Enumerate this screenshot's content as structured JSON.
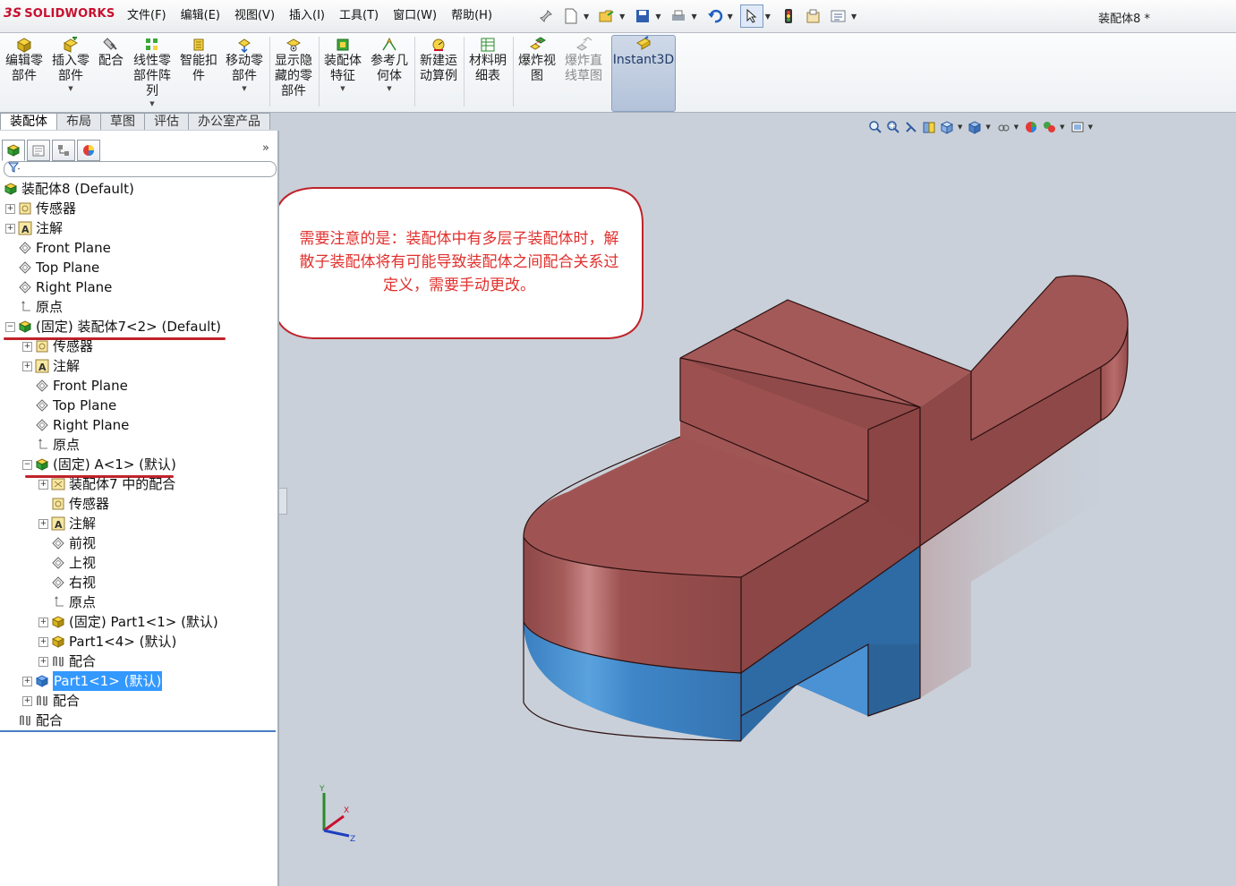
{
  "app": {
    "logo_text": "SOLIDWORKS",
    "document_title": "装配体8 *"
  },
  "menubar": {
    "items": [
      "文件(F)",
      "编辑(E)",
      "视图(V)",
      "插入(I)",
      "工具(T)",
      "窗口(W)",
      "帮助(H)"
    ]
  },
  "quick_toolbar": {
    "icons": [
      "pin-icon",
      "new-document-icon",
      "open-icon",
      "save-icon",
      "print-icon",
      "undo-icon",
      "select-icon",
      "traffic-light-icon",
      "file-properties-icon",
      "options-icon"
    ]
  },
  "command_manager": {
    "buttons": [
      {
        "label": "编辑零\n部件",
        "icon": "edit-component-icon"
      },
      {
        "label": "插入零\n部件",
        "icon": "insert-component-icon"
      },
      {
        "label": "配合",
        "icon": "mate-icon"
      },
      {
        "label": "线性零\n部件阵\n列",
        "icon": "linear-pattern-icon"
      },
      {
        "label": "智能扣\n件",
        "icon": "smart-fasteners-icon"
      },
      {
        "label": "移动零\n部件",
        "icon": "move-component-icon"
      },
      {
        "label": "显示隐\n藏的零\n部件",
        "icon": "show-hidden-icon"
      },
      {
        "label": "装配体\n特征",
        "icon": "assembly-features-icon"
      },
      {
        "label": "参考几\n何体",
        "icon": "reference-geometry-icon"
      },
      {
        "label": "新建运\n动算例",
        "icon": "new-motion-study-icon"
      },
      {
        "label": "材料明\n细表",
        "icon": "bom-icon"
      },
      {
        "label": "爆炸视\n图",
        "icon": "exploded-view-icon"
      },
      {
        "label": "爆炸直\n线草图",
        "icon": "explode-line-sketch-icon"
      },
      {
        "label": "Instant3D",
        "icon": "instant3d-icon"
      }
    ]
  },
  "command_tabs": [
    "装配体",
    "布局",
    "草图",
    "评估",
    "办公室产品"
  ],
  "feature_manager": {
    "tab_icons": [
      "feature-tree-icon",
      "property-manager-icon",
      "configuration-manager-icon",
      "display-manager-icon"
    ],
    "expand_glyph": "»",
    "tree": [
      {
        "label": "装配体8  (Default)",
        "icon": "assembly-icon"
      },
      {
        "label": "传感器",
        "icon": "sensor-icon"
      },
      {
        "label": "注解",
        "icon": "annotation-icon"
      },
      {
        "label": "Front Plane",
        "icon": "plane-icon"
      },
      {
        "label": "Top Plane",
        "icon": "plane-icon"
      },
      {
        "label": "Right Plane",
        "icon": "plane-icon"
      },
      {
        "label": "原点",
        "icon": "origin-icon"
      },
      {
        "label": "(固定) 装配体7<2> (Default)",
        "icon": "subassembly-icon"
      },
      {
        "label": "传感器",
        "icon": "sensor-icon"
      },
      {
        "label": "注解",
        "icon": "annotation-icon"
      },
      {
        "label": "Front Plane",
        "icon": "plane-icon"
      },
      {
        "label": "Top Plane",
        "icon": "plane-icon"
      },
      {
        "label": "Right Plane",
        "icon": "plane-icon"
      },
      {
        "label": "原点",
        "icon": "origin-icon"
      },
      {
        "label": "(固定) A<1> (默认)",
        "icon": "subassembly-icon"
      },
      {
        "label": "装配体7 中的配合",
        "icon": "mates-in-assembly-icon"
      },
      {
        "label": "传感器",
        "icon": "sensor-icon"
      },
      {
        "label": "注解",
        "icon": "annotation-icon"
      },
      {
        "label": "前视",
        "icon": "plane-icon"
      },
      {
        "label": "上视",
        "icon": "plane-icon"
      },
      {
        "label": "右视",
        "icon": "plane-icon"
      },
      {
        "label": "原点",
        "icon": "origin-icon"
      },
      {
        "label": "(固定) Part1<1> (默认)",
        "icon": "part-icon"
      },
      {
        "label": "Part1<4> (默认)",
        "icon": "part-icon"
      },
      {
        "label": "配合",
        "icon": "mates-icon"
      },
      {
        "label": "Part1<1> (默认)",
        "icon": "part-blue-icon"
      },
      {
        "label": "配合",
        "icon": "mates-icon"
      },
      {
        "label": "配合",
        "icon": "mates-icon"
      }
    ]
  },
  "heads_up_toolbar": {
    "icons": [
      "zoom-to-fit-icon",
      "zoom-to-area-icon",
      "previous-view-icon",
      "section-view-icon",
      "view-orientation-icon",
      "display-style-icon",
      "hide-show-items-icon",
      "edit-appearance-icon",
      "apply-scene-icon",
      "view-settings-icon"
    ]
  },
  "callout": {
    "text": "需要注意的是：装配体中有多层子装配体时，解散子装配体将有可能导致装配体之间配合关系过定义，需要手动更改。",
    "color": "#e0302d"
  },
  "model_colors": {
    "top_part": "#9c5150",
    "bottom_part": "#3f86c8"
  },
  "triad": {
    "axis_labels": [
      "Y",
      "X",
      "Z"
    ]
  }
}
